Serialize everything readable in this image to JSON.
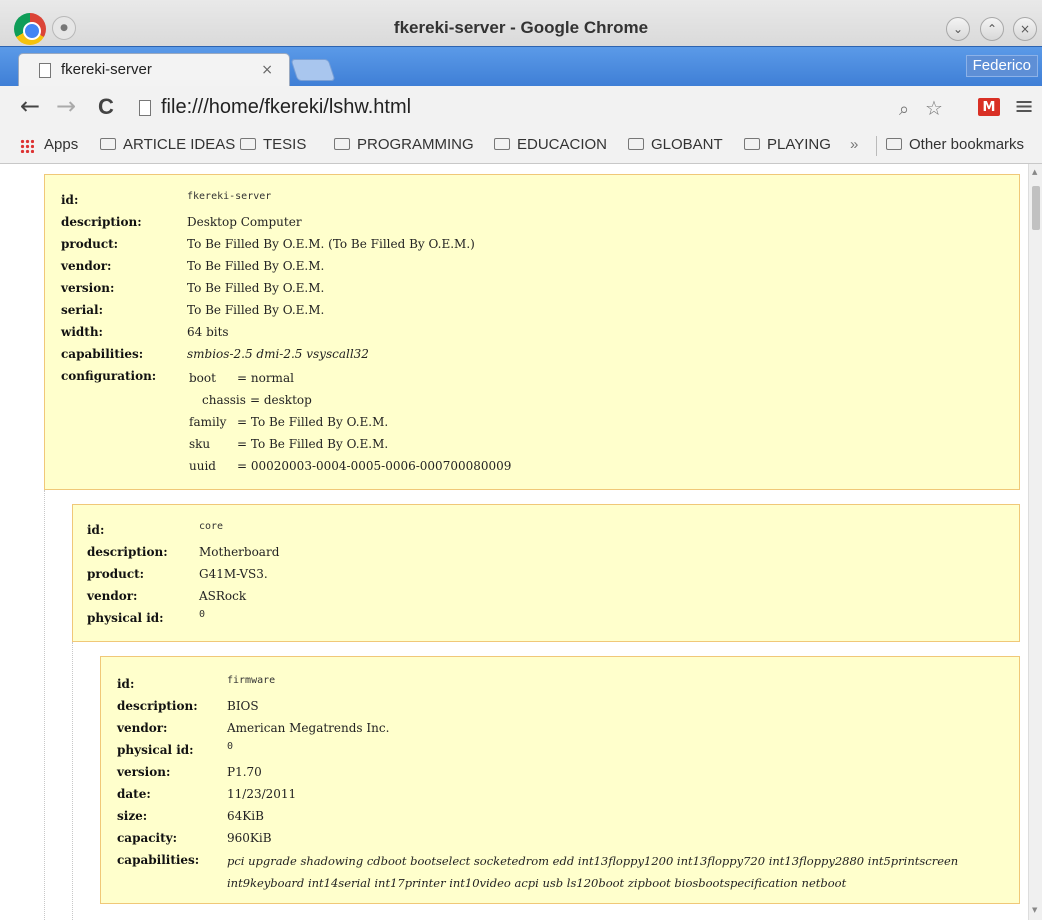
{
  "window": {
    "title": "fkereki-server - Google Chrome",
    "minimize_glyph": "⌄",
    "maximize_glyph": "⌃",
    "close_glyph": "×"
  },
  "tab": {
    "title": "fkereki-server",
    "close_glyph": "×"
  },
  "profile": {
    "name": "Federico"
  },
  "toolbar": {
    "back_glyph": "←",
    "forward_glyph": "→",
    "reload_glyph": "C",
    "url": "file:///home/fkereki/lshw.html",
    "zoom_glyph": "⌕",
    "star_glyph": "☆",
    "gmail_glyph": "M",
    "menu_glyph": "≡"
  },
  "bookmarks": {
    "apps": "Apps",
    "items": [
      "ARTICLE IDEAS",
      "TESIS",
      "PROGRAMMING",
      "EDUCACION",
      "GLOBANT",
      "PLAYING"
    ],
    "overflow": "»",
    "other": "Other bookmarks"
  },
  "nodes": {
    "server": {
      "rows": [
        {
          "key": "id:",
          "value": "fkereki-server"
        },
        {
          "key": "description:",
          "value": "Desktop Computer"
        },
        {
          "key": "product:",
          "value": "To Be Filled By O.E.M. (To Be Filled By O.E.M.)"
        },
        {
          "key": "vendor:",
          "value": "To Be Filled By O.E.M."
        },
        {
          "key": "version:",
          "value": "To Be Filled By O.E.M."
        },
        {
          "key": "serial:",
          "value": "To Be Filled By O.E.M."
        },
        {
          "key": "width:",
          "value": "64 bits"
        },
        {
          "key": "capabilities:",
          "value": "smbios-2.5 dmi-2.5 vsyscall32"
        },
        {
          "key": "configuration:",
          "value": ""
        }
      ],
      "configuration": [
        {
          "k": "boot",
          "v": "= normal"
        },
        {
          "k": "chassis",
          "v": "= desktop"
        },
        {
          "k": "family",
          "v": "= To Be Filled By O.E.M."
        },
        {
          "k": "sku",
          "v": "= To Be Filled By O.E.M."
        },
        {
          "k": "uuid",
          "v": "= 00020003-0004-0005-0006-000700080009"
        }
      ]
    },
    "core": {
      "rows": [
        {
          "key": "id:",
          "value": "core"
        },
        {
          "key": "description:",
          "value": "Motherboard"
        },
        {
          "key": "product:",
          "value": "G41M-VS3."
        },
        {
          "key": "vendor:",
          "value": "ASRock"
        },
        {
          "key": "physical id:",
          "value": "0"
        }
      ]
    },
    "firmware": {
      "rows": [
        {
          "key": "id:",
          "value": "firmware"
        },
        {
          "key": "description:",
          "value": "BIOS"
        },
        {
          "key": "vendor:",
          "value": "American Megatrends Inc."
        },
        {
          "key": "physical id:",
          "value": "0"
        },
        {
          "key": "version:",
          "value": "P1.70"
        },
        {
          "key": "date:",
          "value": "11/23/2011"
        },
        {
          "key": "size:",
          "value": "64KiB"
        },
        {
          "key": "capacity:",
          "value": "960KiB"
        },
        {
          "key": "capabilities:",
          "value": ""
        }
      ],
      "capabilities_lines": [
        "pci upgrade shadowing cdboot bootselect socketedrom edd int13floppy1200 int13floppy720 int13floppy2880 int5printscreen",
        "int9keyboard int14serial int17printer int10video acpi usb ls120boot zipboot biosbootspecification netboot"
      ]
    }
  }
}
